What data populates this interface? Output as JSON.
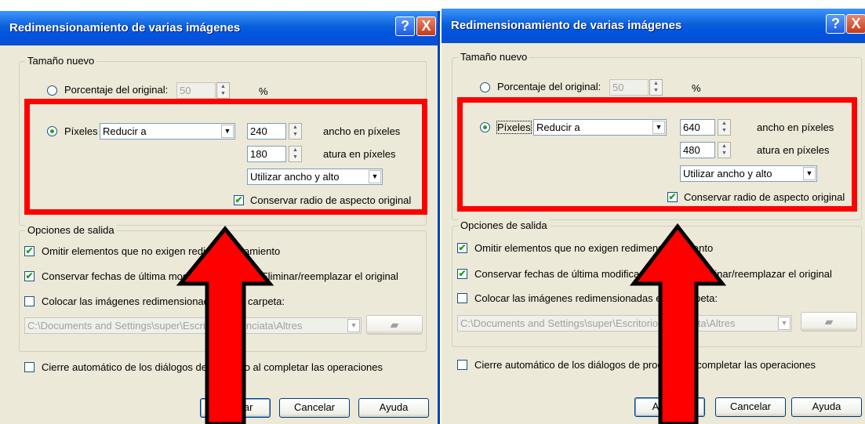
{
  "dialogs": [
    {
      "title": "Redimensionamiento de varias imágenes",
      "help_button": "?",
      "close_button": "X",
      "new_size_legend": "Tamaño nuevo",
      "percent_label": "Porcentaje del original:",
      "percent_value": "50",
      "percent_unit": "%",
      "pixels_label": "Píxeles",
      "mode_value": "Reducir a",
      "width_value": "240",
      "width_label": "ancho en píxeles",
      "height_value": "180",
      "height_label": "atura en píxeles",
      "use_value": "Utilizar ancho y alto",
      "keep_ratio_label": "Conservar radio de aspecto original",
      "output_legend": "Opciones de salida",
      "omit_label": "Omitir elementos que no exigen redimensionamiento",
      "keep_dates_label": "Conservar fechas de última modificación",
      "delete_label": "Eliminar/reemplazar el original",
      "place_label": "Colocar las imágenes redimensionadas en la carpeta:",
      "folder_path": "C:\\Documents and Settings\\super\\Escritorio\\Anunciata\\Altres",
      "autoclose_label": "Cierre automático de los diálogos de progreso al completar las operaciones",
      "accept_label": "Aceptar",
      "cancel_label": "Cancelar",
      "help_label": "Ayuda"
    },
    {
      "title": "Redimensionamiento de varias imágenes",
      "help_button": "?",
      "close_button": "X",
      "new_size_legend": "Tamaño nuevo",
      "percent_label": "Porcentaje del original:",
      "percent_value": "50",
      "percent_unit": "%",
      "pixels_label": "Píxeles",
      "mode_value": "Reducir a",
      "width_value": "640",
      "width_label": "ancho en píxeles",
      "height_value": "480",
      "height_label": "atura en píxeles",
      "use_value": "Utilizar ancho y alto",
      "keep_ratio_label": "Conservar radio de aspecto original",
      "output_legend": "Opciones de salida",
      "omit_label": "Omitir elementos que no exigen redimensionamiento",
      "keep_dates_label": "Conservar fechas de última modificación",
      "delete_label": "Eliminar/reemplazar el original",
      "place_label": "Colocar las imágenes redimensionadas en la carpeta:",
      "folder_path": "C:\\Documents and Settings\\super\\Escritorio\\Anunciata\\Altres",
      "autoclose_label": "Cierre automático de los diálogos de progreso al completar las operaciones",
      "accept_label": "Aceptar",
      "cancel_label": "Cancelar",
      "help_label": "Ayuda"
    }
  ],
  "colors": {
    "highlight_box": "#ff0000",
    "arrow_fill": "#ff0000",
    "arrow_outline": "#000000",
    "titlebar": "#0053e1",
    "dialog_bg": "#ece9d8"
  }
}
